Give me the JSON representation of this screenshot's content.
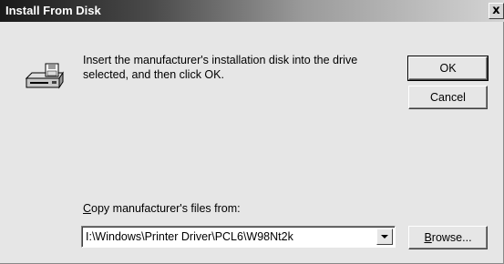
{
  "window": {
    "title": "Install From Disk",
    "close_glyph": "x"
  },
  "message": "Insert the manufacturer's installation disk into the drive selected, and then click OK.",
  "buttons": {
    "ok": "OK",
    "cancel": "Cancel",
    "browse_accel": "B",
    "browse_rest": "rowse..."
  },
  "copy_from": {
    "label_accel": "C",
    "label_rest": "opy manufacturer's files from:",
    "value": "I:\\Windows\\Printer Driver\\PCL6\\W98Nt2k"
  },
  "icons": {
    "disk": "floppy-drive-icon",
    "dropdown": "chevron-down-icon"
  }
}
